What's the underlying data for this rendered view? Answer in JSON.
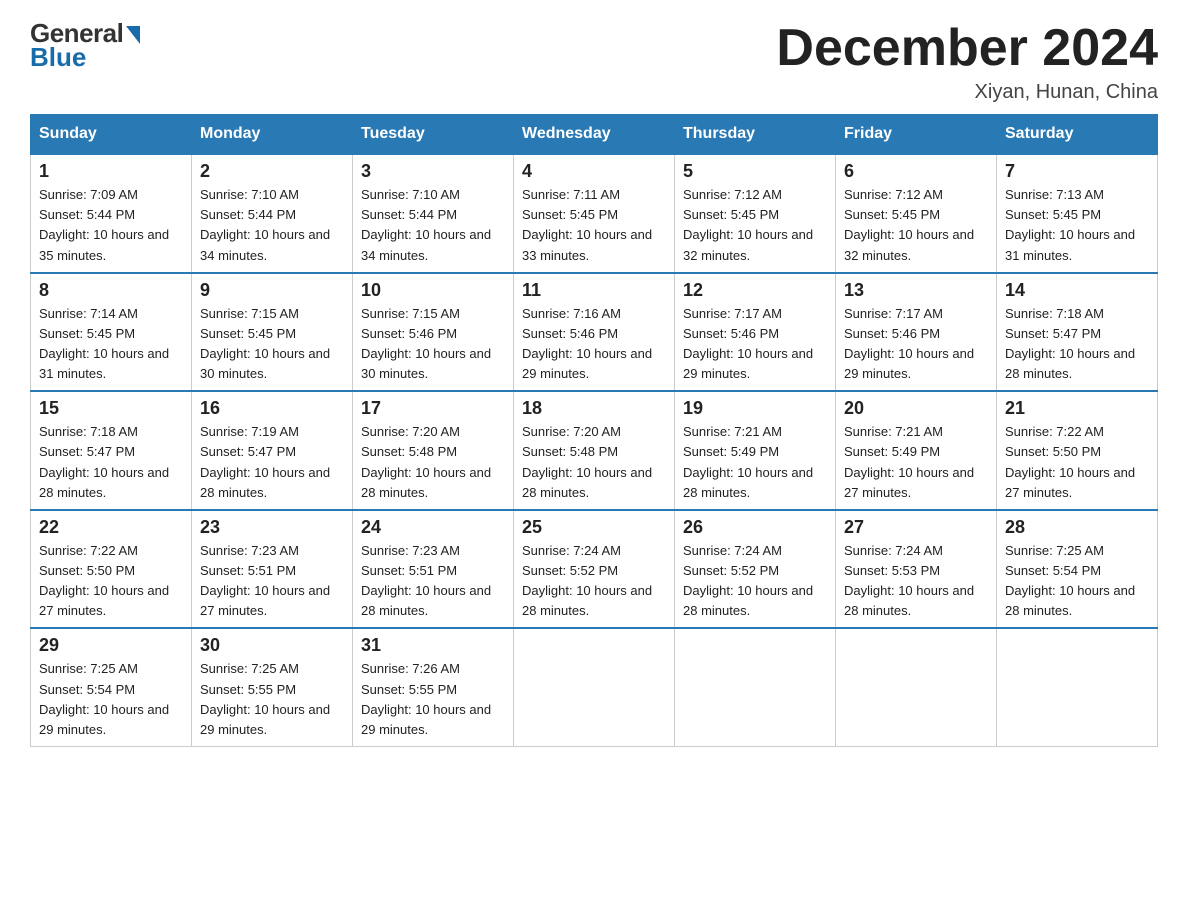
{
  "logo": {
    "general": "General",
    "blue": "Blue"
  },
  "title": "December 2024",
  "location": "Xiyan, Hunan, China",
  "days_of_week": [
    "Sunday",
    "Monday",
    "Tuesday",
    "Wednesday",
    "Thursday",
    "Friday",
    "Saturday"
  ],
  "weeks": [
    [
      {
        "day": "1",
        "sunrise": "7:09 AM",
        "sunset": "5:44 PM",
        "daylight": "10 hours and 35 minutes."
      },
      {
        "day": "2",
        "sunrise": "7:10 AM",
        "sunset": "5:44 PM",
        "daylight": "10 hours and 34 minutes."
      },
      {
        "day": "3",
        "sunrise": "7:10 AM",
        "sunset": "5:44 PM",
        "daylight": "10 hours and 34 minutes."
      },
      {
        "day": "4",
        "sunrise": "7:11 AM",
        "sunset": "5:45 PM",
        "daylight": "10 hours and 33 minutes."
      },
      {
        "day": "5",
        "sunrise": "7:12 AM",
        "sunset": "5:45 PM",
        "daylight": "10 hours and 32 minutes."
      },
      {
        "day": "6",
        "sunrise": "7:12 AM",
        "sunset": "5:45 PM",
        "daylight": "10 hours and 32 minutes."
      },
      {
        "day": "7",
        "sunrise": "7:13 AM",
        "sunset": "5:45 PM",
        "daylight": "10 hours and 31 minutes."
      }
    ],
    [
      {
        "day": "8",
        "sunrise": "7:14 AM",
        "sunset": "5:45 PM",
        "daylight": "10 hours and 31 minutes."
      },
      {
        "day": "9",
        "sunrise": "7:15 AM",
        "sunset": "5:45 PM",
        "daylight": "10 hours and 30 minutes."
      },
      {
        "day": "10",
        "sunrise": "7:15 AM",
        "sunset": "5:46 PM",
        "daylight": "10 hours and 30 minutes."
      },
      {
        "day": "11",
        "sunrise": "7:16 AM",
        "sunset": "5:46 PM",
        "daylight": "10 hours and 29 minutes."
      },
      {
        "day": "12",
        "sunrise": "7:17 AM",
        "sunset": "5:46 PM",
        "daylight": "10 hours and 29 minutes."
      },
      {
        "day": "13",
        "sunrise": "7:17 AM",
        "sunset": "5:46 PM",
        "daylight": "10 hours and 29 minutes."
      },
      {
        "day": "14",
        "sunrise": "7:18 AM",
        "sunset": "5:47 PM",
        "daylight": "10 hours and 28 minutes."
      }
    ],
    [
      {
        "day": "15",
        "sunrise": "7:18 AM",
        "sunset": "5:47 PM",
        "daylight": "10 hours and 28 minutes."
      },
      {
        "day": "16",
        "sunrise": "7:19 AM",
        "sunset": "5:47 PM",
        "daylight": "10 hours and 28 minutes."
      },
      {
        "day": "17",
        "sunrise": "7:20 AM",
        "sunset": "5:48 PM",
        "daylight": "10 hours and 28 minutes."
      },
      {
        "day": "18",
        "sunrise": "7:20 AM",
        "sunset": "5:48 PM",
        "daylight": "10 hours and 28 minutes."
      },
      {
        "day": "19",
        "sunrise": "7:21 AM",
        "sunset": "5:49 PM",
        "daylight": "10 hours and 28 minutes."
      },
      {
        "day": "20",
        "sunrise": "7:21 AM",
        "sunset": "5:49 PM",
        "daylight": "10 hours and 27 minutes."
      },
      {
        "day": "21",
        "sunrise": "7:22 AM",
        "sunset": "5:50 PM",
        "daylight": "10 hours and 27 minutes."
      }
    ],
    [
      {
        "day": "22",
        "sunrise": "7:22 AM",
        "sunset": "5:50 PM",
        "daylight": "10 hours and 27 minutes."
      },
      {
        "day": "23",
        "sunrise": "7:23 AM",
        "sunset": "5:51 PM",
        "daylight": "10 hours and 27 minutes."
      },
      {
        "day": "24",
        "sunrise": "7:23 AM",
        "sunset": "5:51 PM",
        "daylight": "10 hours and 28 minutes."
      },
      {
        "day": "25",
        "sunrise": "7:24 AM",
        "sunset": "5:52 PM",
        "daylight": "10 hours and 28 minutes."
      },
      {
        "day": "26",
        "sunrise": "7:24 AM",
        "sunset": "5:52 PM",
        "daylight": "10 hours and 28 minutes."
      },
      {
        "day": "27",
        "sunrise": "7:24 AM",
        "sunset": "5:53 PM",
        "daylight": "10 hours and 28 minutes."
      },
      {
        "day": "28",
        "sunrise": "7:25 AM",
        "sunset": "5:54 PM",
        "daylight": "10 hours and 28 minutes."
      }
    ],
    [
      {
        "day": "29",
        "sunrise": "7:25 AM",
        "sunset": "5:54 PM",
        "daylight": "10 hours and 29 minutes."
      },
      {
        "day": "30",
        "sunrise": "7:25 AM",
        "sunset": "5:55 PM",
        "daylight": "10 hours and 29 minutes."
      },
      {
        "day": "31",
        "sunrise": "7:26 AM",
        "sunset": "5:55 PM",
        "daylight": "10 hours and 29 minutes."
      },
      null,
      null,
      null,
      null
    ]
  ]
}
